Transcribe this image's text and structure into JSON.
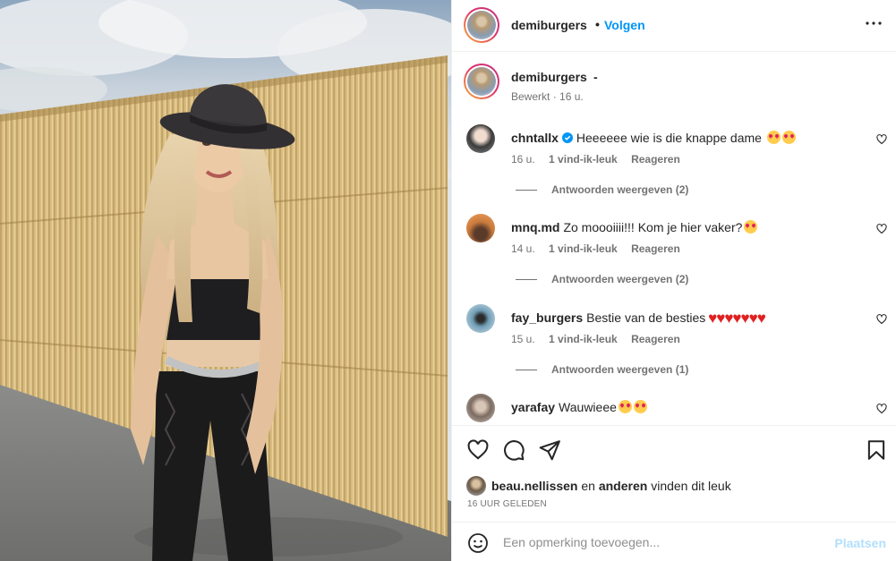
{
  "header": {
    "username": "demiburgers",
    "separator": "•",
    "follow_label": "Volgen",
    "more_icon": "more-horizontal-icon"
  },
  "caption": {
    "username": "demiburgers",
    "text": "-",
    "edited": "Bewerkt",
    "separator": "·",
    "time": "16 u."
  },
  "comments": [
    {
      "username": "chntallx",
      "verified": true,
      "text": "Heeeeee wie is die knappe dame",
      "time": "16 u.",
      "likes": "1 vind-ik-leuk",
      "reply_label": "Reageren",
      "replies_label": "Antwoorden weergeven (2)"
    },
    {
      "username": "mnq.md",
      "verified": false,
      "text": "Zo moooiiii!!! Kom je hier vaker?",
      "time": "14 u.",
      "likes": "1 vind-ik-leuk",
      "reply_label": "Reageren",
      "replies_label": "Antwoorden weergeven (2)"
    },
    {
      "username": "fay_burgers",
      "verified": false,
      "text": "Bestie van de besties",
      "time": "15 u.",
      "likes": "1 vind-ik-leuk",
      "reply_label": "Reageren",
      "replies_label": "Antwoorden weergeven (1)"
    },
    {
      "username": "yarafay",
      "verified": false,
      "text": "Wauwieee",
      "time": "",
      "likes": "",
      "reply_label": "",
      "replies_label": ""
    }
  ],
  "actions": {
    "like_icon": "heart-icon",
    "comment_icon": "comment-icon",
    "share_icon": "paper-plane-icon",
    "save_icon": "bookmark-icon"
  },
  "likes": {
    "liker": "beau.nellissen",
    "conj": "en",
    "others": "anderen",
    "suffix": "vinden dit leuk"
  },
  "timeago": "16 UUR GELEDEN",
  "add_comment": {
    "placeholder": "Een opmerking toevoegen...",
    "post_label": "Plaatsen",
    "emoji_icon": "smiley-icon"
  },
  "colors": {
    "accent": "#0095f6",
    "accent_disabled": "#b2dffc",
    "muted": "#737373",
    "text": "#262626"
  }
}
